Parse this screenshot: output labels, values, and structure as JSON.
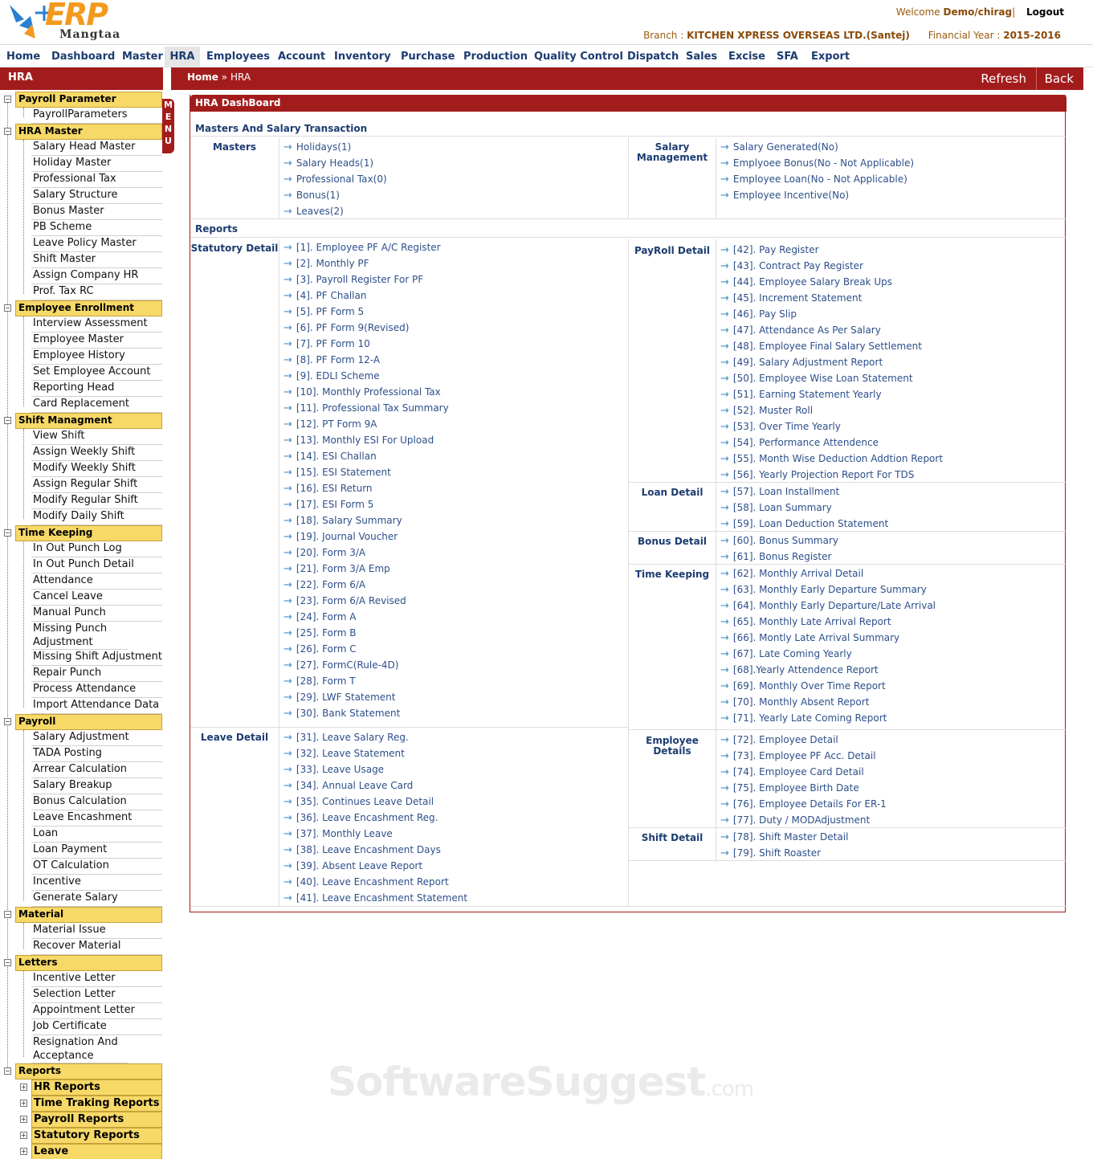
{
  "app": {
    "logo_text": "ERP",
    "logo_sub": "Mangtaa"
  },
  "header": {
    "welcome_label": "Welcome",
    "user": "Demo/chirag",
    "separator": "|",
    "logout": "Logout",
    "branch_label": "Branch :",
    "branch": "KITCHEN XPRESS OVERSEAS LTD.(Santej)",
    "fy_label": "Financial Year :",
    "fy": "2015-2016"
  },
  "topnav": [
    "Home",
    "Dashboard",
    "Master",
    "HRA",
    "Employees",
    "Account",
    "Inventory",
    "Purchase",
    "Production",
    "Quality Control",
    "Dispatch",
    "Sales",
    "Excise",
    "SFA",
    "Export"
  ],
  "sidebar": {
    "title": "HRA",
    "menu_tab": "MENU",
    "sections": [
      {
        "label": "Payroll Parameter",
        "items": [
          "PayrollParameters"
        ]
      },
      {
        "label": "HRA Master",
        "items": [
          "Salary Head Master",
          "Holiday Master",
          "Professional Tax",
          "Salary Structure",
          "Bonus Master",
          "PB Scheme",
          "Leave Policy Master",
          "Shift Master",
          "Assign Company HR",
          "Prof. Tax RC"
        ]
      },
      {
        "label": "Employee Enrollment",
        "items": [
          "Interview Assessment",
          "Employee Master",
          "Employee History",
          "Set Employee Account",
          "Reporting Head",
          "Card Replacement"
        ]
      },
      {
        "label": "Shift Managment",
        "items": [
          "View Shift",
          "Assign Weekly Shift",
          "Modify Weekly Shift",
          "Assign Regular Shift",
          "Modify Regular Shift",
          "Modify Daily Shift"
        ]
      },
      {
        "label": "Time Keeping",
        "items": [
          "In Out Punch Log",
          "In Out Punch Detail",
          "Attendance",
          "Cancel Leave",
          "Manual Punch",
          "Missing Punch Adjustment",
          "Missing Shift Adjustment",
          "Repair Punch",
          "Process Attendance",
          "Import Attendance Data"
        ]
      },
      {
        "label": "Payroll",
        "items": [
          "Salary Adjustment",
          "TADA Posting",
          "Arrear Calculation",
          "Salary Breakup",
          "Bonus Calculation",
          "Leave Encashment",
          "Loan",
          "Loan Payment",
          "OT Calculation",
          "Incentive",
          "Generate Salary"
        ]
      },
      {
        "label": "Material",
        "items": [
          "Material Issue",
          "Recover Material"
        ]
      },
      {
        "label": "Letters",
        "items": [
          "Incentive Letter",
          "Selection Letter",
          "Appointment Letter",
          "Job Certificate",
          "Resignation And Acceptance Letter"
        ]
      },
      {
        "label": "Reports",
        "items": []
      }
    ],
    "report_subsections": [
      "HR Reports",
      "Time Traking Reports",
      "Payroll Reports",
      "Statutory Reports",
      "Leave"
    ]
  },
  "breadcrumb": {
    "home": "Home",
    "sep": "»",
    "current": "HRA",
    "refresh": "Refresh",
    "back": "Back"
  },
  "dashboard": {
    "title": "HRA DashBoard",
    "masters_heading": "Masters And Salary Transaction",
    "masters_cat": "Masters",
    "masters": [
      "Holidays(1)",
      "Salary Heads(1)",
      "Professional Tax(0)",
      "Bonus(1)",
      "Leaves(2)"
    ],
    "salary_cat": "Salary Management",
    "salary": [
      "Salary Generated(No)",
      "Emplyoee Bonus(No - Not Applicable)",
      "Employee Loan(No - Not Applicable)",
      "Employee Incentive(No)"
    ],
    "reports_heading": "Reports",
    "statutory_cat": "Statutory Detail",
    "statutory": [
      "[1]. Employee PF A/C Register",
      "[2]. Monthly PF",
      "[3]. Payroll Register For PF",
      "[4]. PF Challan",
      "[5]. PF Form 5",
      "[6]. PF Form 9(Revised)",
      "[7]. PF Form 10",
      "[8]. PF Form 12-A",
      "[9]. EDLI Scheme",
      "[10]. Monthly Professional Tax",
      "[11]. Professional Tax Summary",
      "[12]. PT Form 9A",
      "[13]. Monthly ESI For Upload",
      "[14]. ESI Challan",
      "[15]. ESI Statement",
      "[16]. ESI Return",
      "[17]. ESI Form 5",
      "[18]. Salary Summary",
      "[19]. Journal Voucher",
      "[20]. Form 3/A",
      "[21]. Form 3/A Emp",
      "[22]. Form 6/A",
      "[23]. Form 6/A Revised",
      "[24]. Form A",
      "[25]. Form B",
      "[26]. Form C",
      "[27]. FormC(Rule-4D)",
      "[28]. Form T",
      "[29]. LWF Statement",
      "[30]. Bank Statement"
    ],
    "leave_cat": "Leave Detail",
    "leave": [
      "[31]. Leave Salary Reg.",
      "[32]. Leave Statement",
      "[33]. Leave Usage",
      "[34]. Annual Leave Card",
      "[35]. Continues Leave Detail",
      "[36]. Leave Encashment Reg.",
      "[37]. Monthly Leave",
      "[38]. Leave Encashment Days",
      "[39]. Absent Leave Report",
      "[40]. Leave Encashment Report",
      "[41]. Leave Encashment Statement"
    ],
    "payroll_cat": "PayRoll Detail",
    "payroll": [
      "[42]. Pay Register",
      "[43]. Contract Pay Register",
      "[44]. Employee Salary Break Ups",
      "[45]. Increment Statement",
      "[46]. Pay Slip",
      "[47]. Attendance As Per Salary",
      "[48]. Employee Final Salary Settlement",
      "[49]. Salary Adjustment Report",
      "[50]. Employee Wise Loan Statement",
      "[51]. Earning Statement Yearly",
      "[52]. Muster Roll",
      "[53]. Over Time Yearly",
      "[54]. Performance Attendence",
      "[55]. Month Wise Deduction Addtion Report",
      "[56]. Yearly Projection Report For TDS"
    ],
    "loan_cat": "Loan Detail",
    "loan": [
      "[57]. Loan Installment",
      "[58]. Loan Summary",
      "[59]. Loan Deduction Statement"
    ],
    "bonus_cat": "Bonus Detail",
    "bonus": [
      "[60]. Bonus Summary",
      "[61]. Bonus Register"
    ],
    "time_cat": "Time Keeping",
    "time": [
      "[62]. Monthly Arrival Detail",
      "[63]. Monthly Early Departure Summary",
      "[64]. Monthly Early Departure/Late Arrival",
      "[65]. Monthly Late Arrival Report",
      "[66]. Montly Late Arrival Summary",
      "[67]. Late Coming Yearly",
      "[68].Yearly Attendence Report",
      "[69]. Monthly Over Time Report",
      "[70]. Monthly Absent Report",
      "[71]. Yearly Late Coming Report"
    ],
    "emp_cat": "Employee Details",
    "emp": [
      "[72]. Employee Detail",
      "[73]. Employee PF Acc. Detail",
      "[74]. Employee Card Detail",
      "[75]. Employee Birth Date",
      "[76]. Employee Details For ER-1",
      "[77]. Duty / MODAdjustment"
    ],
    "shift_cat": "Shift Detail",
    "shift": [
      "[78]. Shift Master Detail",
      "[79]. Shift Roaster"
    ]
  },
  "watermark": {
    "main": "SoftwareSuggest",
    "suffix": ".com"
  }
}
